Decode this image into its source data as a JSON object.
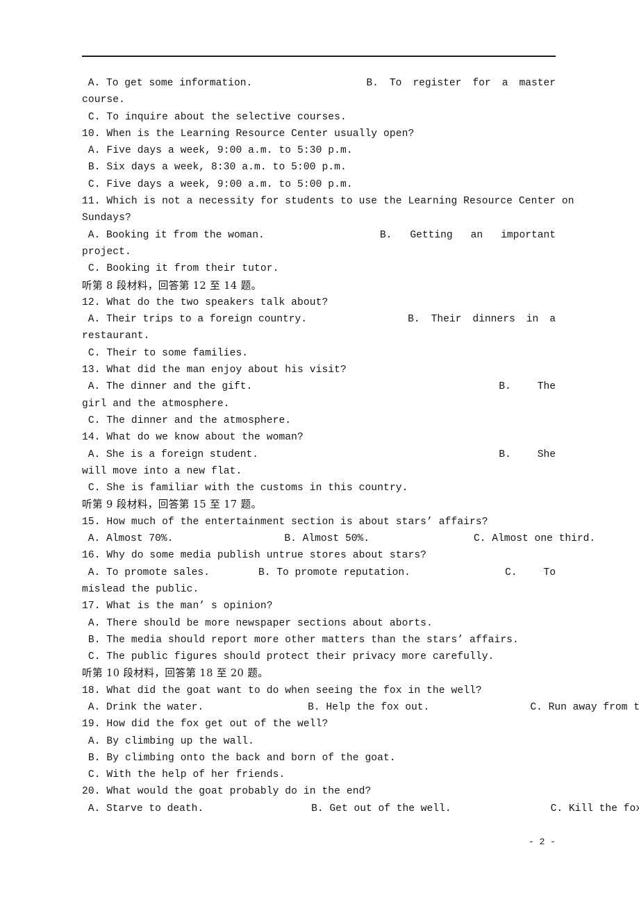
{
  "page": {
    "page_number_label": "- 2 -",
    "rule_color": "#1a1a1a",
    "text_color": "#141414",
    "background": "#ffffff"
  },
  "lines": [
    {
      "id": "q9_optA",
      "left": " A. To get some information.",
      "right_parts": [
        "B.",
        "To",
        "register",
        "for",
        "a",
        "master"
      ]
    },
    {
      "id": "q9_optB_wrap",
      "text": "course."
    },
    {
      "id": "q9_optC",
      "text": " C. To inquire about the selective courses."
    },
    {
      "id": "q10_stem",
      "text": "10. When is the Learning Resource Center usually open?"
    },
    {
      "id": "q10_optA",
      "text": " A. Five days a week, 9:00 a.m. to 5:30 p.m."
    },
    {
      "id": "q10_optB",
      "text": " B. Six days a week, 8:30 a.m. to 5:00 p.m."
    },
    {
      "id": "q10_optC",
      "text": " C. Five days a week, 9:00 a.m. to 5:00 p.m."
    },
    {
      "id": "q11_stem",
      "text": "11. Which is not a necessity for students to use the Learning Resource Center on"
    },
    {
      "id": "q11_stem_wrap",
      "text": "Sundays?"
    },
    {
      "id": "q11_optA",
      "left": " A. Booking it from the woman.",
      "right_parts": [
        "B.",
        "Getting",
        "an",
        "important"
      ]
    },
    {
      "id": "q11_optB_wrap",
      "text": "project."
    },
    {
      "id": "q11_optC",
      "text": " C. Booking it from their tutor."
    },
    {
      "id": "cn_dir_8",
      "text": "听第 8 段材料，回答第 12 至 14 题。"
    },
    {
      "id": "q12_stem",
      "text": "12. What do the two speakers talk about?"
    },
    {
      "id": "q12_optA",
      "left": " A. Their trips to a foreign country.",
      "right_parts": [
        "B.",
        "Their",
        "dinners",
        "in",
        "a"
      ]
    },
    {
      "id": "q12_optB_wrap",
      "text": "restaurant."
    },
    {
      "id": "q12_optC",
      "text": " C. Their to some families."
    },
    {
      "id": "q13_stem",
      "text": "13. What did the man enjoy about his visit?"
    },
    {
      "id": "q13_optA",
      "left": " A. The dinner and the gift.",
      "right_parts": [
        "B.",
        "The"
      ]
    },
    {
      "id": "q13_optB_wrap",
      "text": "girl and the atmosphere."
    },
    {
      "id": "q13_optC",
      "text": " C. The dinner and the atmosphere."
    },
    {
      "id": "q14_stem",
      "text": "14. What do we know about the woman?"
    },
    {
      "id": "q14_optA",
      "left": " A. She is a foreign student.",
      "right_parts": [
        "B.",
        "She"
      ]
    },
    {
      "id": "q14_optB_wrap",
      "text": "will move into a new flat."
    },
    {
      "id": "q14_optC",
      "text": " C. She is familiar with the customs in this country."
    },
    {
      "id": "cn_dir_9",
      "text": "听第 9 段材料，回答第 15 至 17 题。"
    },
    {
      "id": "q15_stem",
      "text": "15. How much of the entertainment section is about stars’ affairs?"
    },
    {
      "id": "q15_opts",
      "opts": [
        " A. Almost 70%.",
        "B. Almost 50%.",
        "C. Almost one third."
      ],
      "tabs": [
        0,
        160,
        310
      ]
    },
    {
      "id": "q16_stem",
      "text": "16. Why do some media publish untrue stores about stars?"
    },
    {
      "id": "q16_optAB",
      "left": " A. To promote sales.        B. To promote reputation.",
      "right_parts": [
        "C.",
        "To"
      ]
    },
    {
      "id": "q16_optC_wrap",
      "text": "mislead the public."
    },
    {
      "id": "q17_stem",
      "text": "17. What is the man’ s opinion?"
    },
    {
      "id": "q17_optA",
      "text": " A. There should be more newspaper sections about aborts."
    },
    {
      "id": "q17_optB",
      "text": " B. The media should report more other matters than the stars’ affairs."
    },
    {
      "id": "q17_optC",
      "text": " C. The public figures should protect their privacy more carefully."
    },
    {
      "id": "cn_dir_10",
      "text": "听第 10 段材料，回答第 18 至 20 题。"
    },
    {
      "id": "q18_stem",
      "text": "18. What did the goat want to do when seeing the fox in the well?"
    },
    {
      "id": "q18_opts",
      "opts": [
        " A. Drink the water.",
        "B. Help the fox out.",
        "C. Run away from the well."
      ],
      "tabs": [
        0,
        150,
        295
      ]
    },
    {
      "id": "q19_stem",
      "text": "19. How did the fox get out of the well?"
    },
    {
      "id": "q19_optA",
      "text": " A. By climbing up the wall."
    },
    {
      "id": "q19_optB",
      "text": " B. By climbing onto the back and born of the goat."
    },
    {
      "id": "q19_optC",
      "text": " C. With the help of her friends."
    },
    {
      "id": "q20_stem",
      "text": "20. What would the goat probably do in the end?"
    },
    {
      "id": "q20_opts",
      "opts": [
        " A. Starve to death.",
        "B. Get out of the well.",
        "C. Kill the fox."
      ],
      "tabs": [
        0,
        155,
        298
      ]
    }
  ]
}
